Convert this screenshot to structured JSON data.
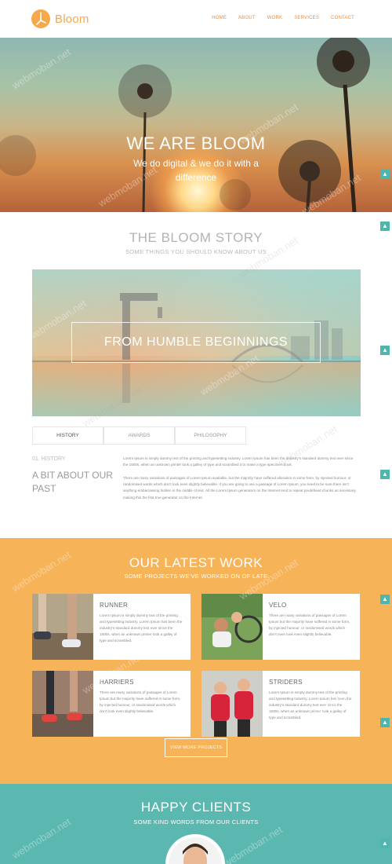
{
  "brand": {
    "name": "Bloom",
    "accent": "#f7a84a"
  },
  "nav": {
    "items": [
      "HOME",
      "ABOUT",
      "WORK",
      "SERVICES",
      "CONTACT"
    ]
  },
  "hero": {
    "title": "WE ARE BLOOM",
    "subtitle": "We do digital & we do it with a difference"
  },
  "story": {
    "title": "THE BLOOM STORY",
    "subtitle": "SOME THINGS YOU SHOULD KNOW ABOUT US",
    "banner": "FROM HUMBLE BEGINNINGS",
    "tabs": [
      "HISTORY",
      "AWARDS",
      "PHILOSOPHY"
    ],
    "history_number": "01. HISTORY",
    "history_heading": "A BIT ABOUT OUR PAST",
    "paragraphs": [
      "Lorem Ipsum is simply dummy text of the printing and typesetting industry. Lorem Ipsum has been the industry's standard dummy text ever since the 1500s, when an unknown printer took a galley of type and scrambled it to make a type specimen book.",
      "There are many variations of passages of Lorem Ipsum available, but the majority have suffered alteration in some form, by injected humour, or randomised words which don't look even slightly believable. If you are going to use a passage of Lorem Ipsum, you need to be sure there isn't anything embarrassing hidden in the middle of text. All the Lorem Ipsum generators on the Internet tend to repeat predefined chunks as necessary, making this the first true generator on the Internet."
    ]
  },
  "work": {
    "title": "OUR LATEST WORK",
    "subtitle": "SOME PROJECTS WE'VE WORKED ON OF LATE",
    "cards": [
      {
        "title": "RUNNER",
        "text": "Lorem Ipsum is simply dummy text of the printing and typesetting industry. Lorem Ipsum has been the industry's standard dummy text ever since the 1500s, when an unknown printer took a galley of type and scrambled."
      },
      {
        "title": "VELO",
        "text": "There are many variations of passages of Lorem Ipsum but the majority have suffered in some form, by injected humour, or randomised words which don't even look even slightly believable."
      },
      {
        "title": "HARRIERS",
        "text": "There are many variations of passages of Lorem Ipsum but the majority have suffered in some form, by injected humour, or randomised words which don't look even slightly believable."
      },
      {
        "title": "STRIDERS",
        "text": "Lorem Ipsum is simply dummy text of the printing and typesetting industry. Lorem Ipsum has been the industry's standard dummy text ever since the 1500s, when an unknown printer took a galley of type and scrambled."
      }
    ],
    "more_button": "VIEW MORE PROJECTS"
  },
  "clients": {
    "title": "HAPPY CLIENTS",
    "subtitle": "SOME KIND WORDS FROM OUR CLIENTS"
  },
  "watermark": "webmoban.net",
  "colors": {
    "orange": "#f7b358",
    "teal": "#5bb8b0",
    "side_tab": "#4fb6ae"
  },
  "icons": [
    "bloom-logo-icon",
    "scroll-up-icon"
  ]
}
